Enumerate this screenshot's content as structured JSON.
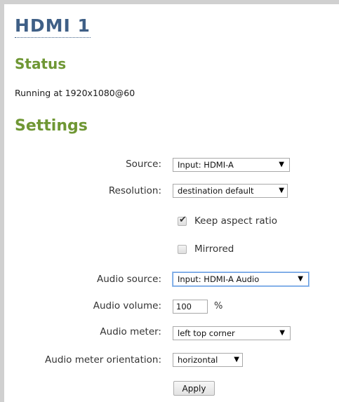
{
  "page": {
    "title": "HDMI 1"
  },
  "status": {
    "heading": "Status",
    "text": "Running at 1920x1080@60"
  },
  "settings": {
    "heading": "Settings",
    "source": {
      "label": "Source:",
      "value": "Input: HDMI-A"
    },
    "resolution": {
      "label": "Resolution:",
      "value": "destination default"
    },
    "keep_aspect_ratio": {
      "label": "Keep aspect ratio",
      "checked": true
    },
    "mirrored": {
      "label": "Mirrored",
      "checked": false
    },
    "audio_source": {
      "label": "Audio source:",
      "value": "Input: HDMI-A Audio"
    },
    "audio_volume": {
      "label": "Audio volume:",
      "value": "100",
      "unit": "%"
    },
    "audio_meter": {
      "label": "Audio meter:",
      "value": "left top corner"
    },
    "audio_meter_orientation": {
      "label": "Audio meter orientation:",
      "value": "horizontal"
    },
    "apply_label": "Apply"
  },
  "icons": {
    "dropdown": "chevron-down-icon",
    "check": "checkmark-icon"
  },
  "colors": {
    "title": "#3f5f86",
    "heading": "#6f9734",
    "focus": "#6b9ee0"
  }
}
